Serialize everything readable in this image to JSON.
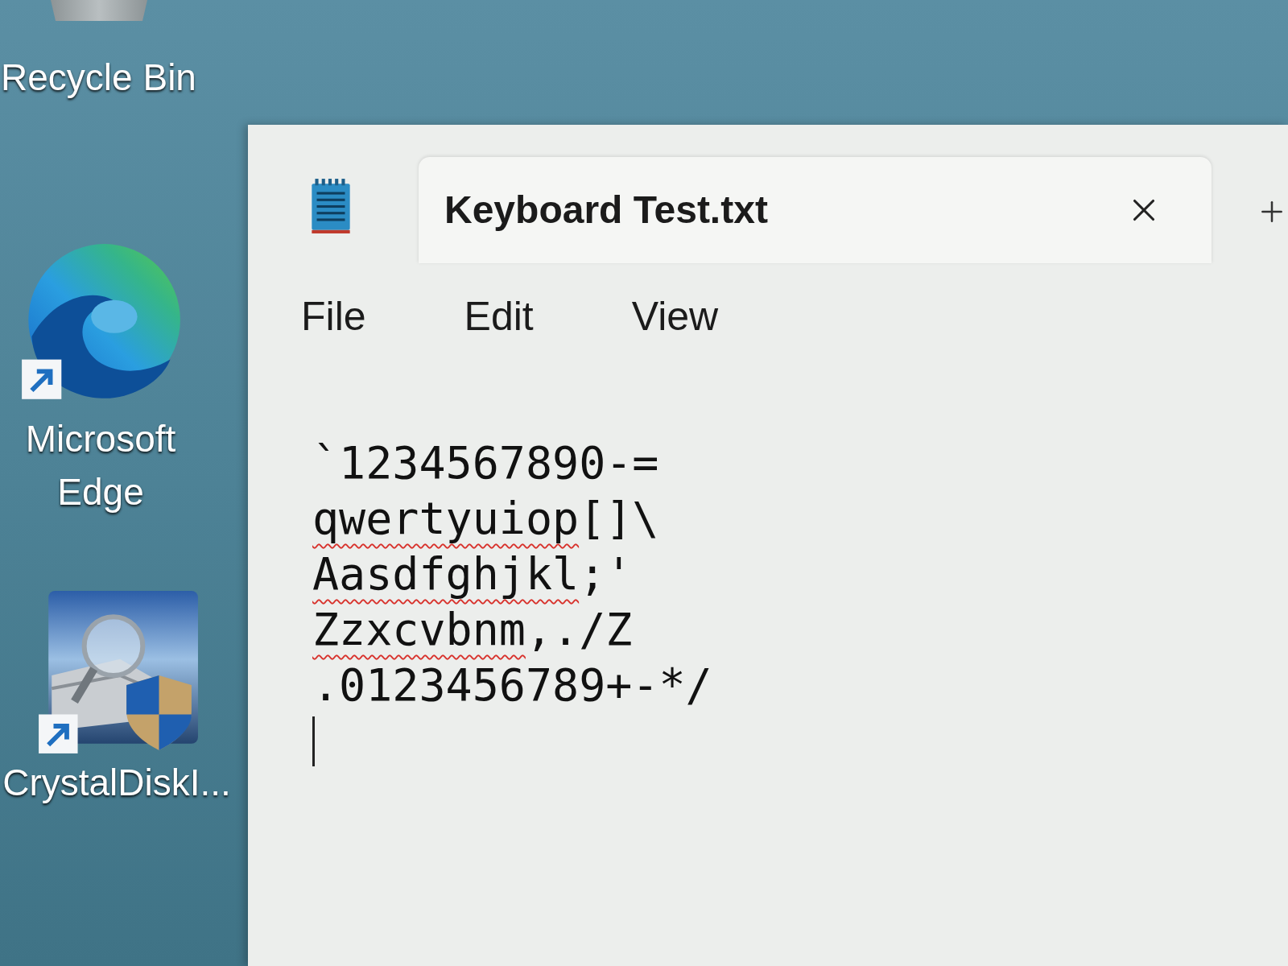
{
  "desktop": {
    "icons": [
      {
        "label": "Recycle Bin",
        "kind": "recycle_bin"
      },
      {
        "label": "Microsoft Edge",
        "kind": "edge",
        "shortcut": true
      },
      {
        "label": "CrystalDiskI...",
        "kind": "crystal_disk",
        "shortcut": true
      }
    ]
  },
  "window": {
    "tabs": [
      {
        "title": "Keyboard Test.txt",
        "selected": true
      }
    ],
    "menu": [
      "File",
      "Edit",
      "View"
    ],
    "editor": {
      "lines": [
        {
          "segments": [
            {
              "text": "`1234567890-=",
              "misspelled": false
            }
          ]
        },
        {
          "segments": [
            {
              "text": "qwertyuiop",
              "misspelled": true
            },
            {
              "text": "[]\\",
              "misspelled": false
            }
          ]
        },
        {
          "segments": [
            {
              "text": "Aasdfghjkl",
              "misspelled": true
            },
            {
              "text": ";'",
              "misspelled": false
            }
          ]
        },
        {
          "segments": [
            {
              "text": "Zzxcvbnm",
              "misspelled": true
            },
            {
              "text": ",./Z",
              "misspelled": false
            }
          ]
        },
        {
          "segments": [
            {
              "text": ".0123456789+-*/",
              "misspelled": false
            }
          ]
        }
      ]
    }
  }
}
